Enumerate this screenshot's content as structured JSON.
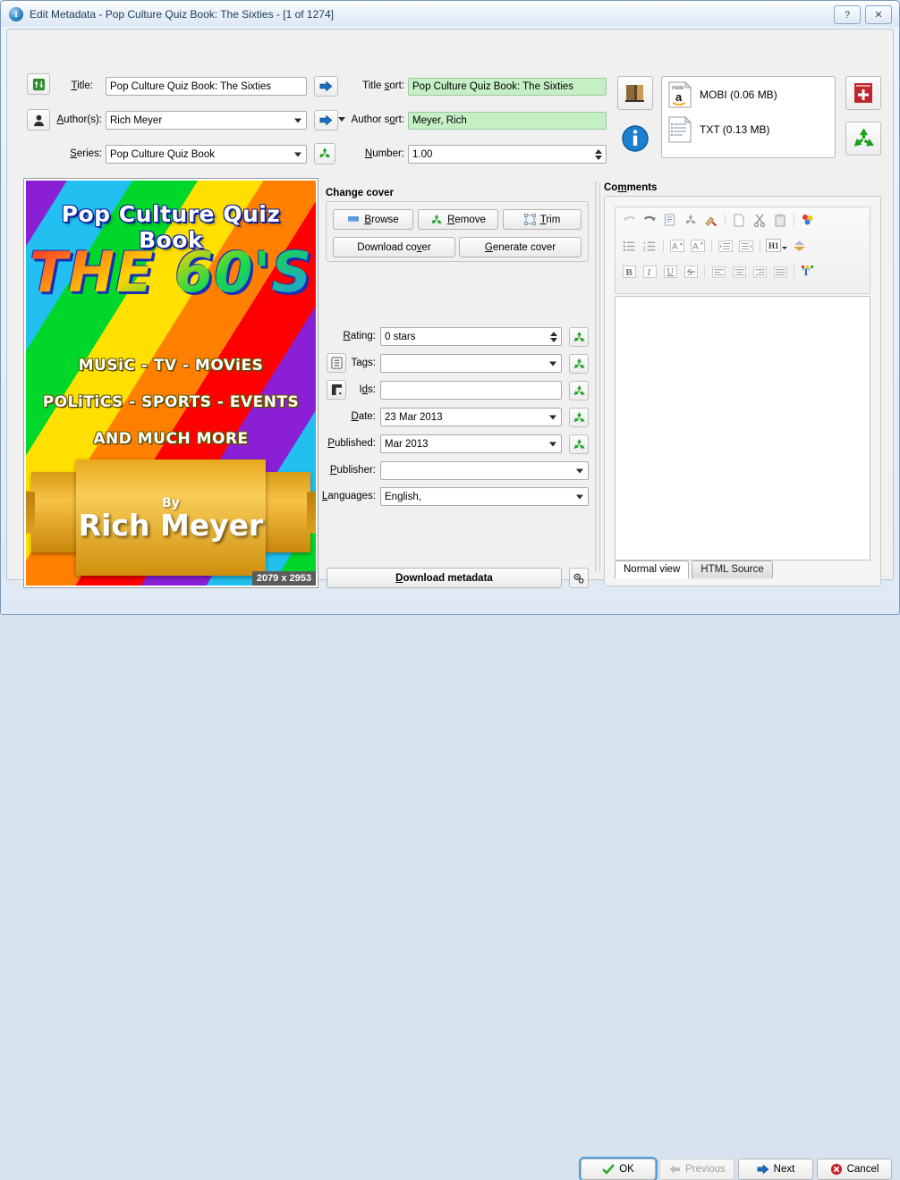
{
  "window": {
    "title": "Edit Metadata - Pop Culture Quiz Book: The Sixties -  [1 of 1274]",
    "icon": "info-icon",
    "help_label": "?",
    "close_label": "✕"
  },
  "metadata": {
    "title_label": "Title:",
    "title_value": "Pop Culture Quiz Book: The Sixties",
    "authors_label": "Author(s):",
    "authors_value": "Rich Meyer",
    "series_label": "Series:",
    "series_value": "Pop Culture Quiz Book",
    "title_sort_label": "Title sort:",
    "title_sort_value": "Pop Culture Quiz Book: The Sixties",
    "author_sort_label": "Author sort:",
    "author_sort_value": "Meyer, Rich",
    "number_label": "Number:",
    "number_value": "1.00"
  },
  "formats": {
    "items": [
      {
        "name": "MOBI (0.06 MB)",
        "icon": "mobi-file-icon",
        "badge": "mobi",
        "mark": "a"
      },
      {
        "name": "TXT (0.13 MB)",
        "icon": "text-file-icon"
      }
    ],
    "book_icon": "book-icon",
    "info_icon": "info-circle-icon",
    "add_format_icon": "add-book-icon",
    "remove_format_icon": "recycle-icon"
  },
  "cover": {
    "frame_label": "cover-preview",
    "title_line": "Pop Culture Quiz Book",
    "decade_line": "THE 60'S",
    "line1": "MUSiC - TV - MOViES",
    "line2": "POLiTiCS - SPORTS - EVENTS",
    "line3": "AND MUCH MORE",
    "by_label": "By",
    "author_name": "Rich Meyer",
    "dimensions": "2079 x 2953"
  },
  "change_cover": {
    "group_title": "Change cover",
    "browse": "Browse",
    "browse_accel": "B",
    "remove": "Remove",
    "remove_accel": "R",
    "trim": "Trim",
    "trim_accel": "T",
    "download_cover": "Download cover",
    "download_cover_accel": "v",
    "generate_cover": "Generate cover",
    "generate_cover_accel": "G"
  },
  "fields": [
    {
      "label": "Rating:",
      "accel": "R",
      "value": "0 stars",
      "kind": "spin",
      "reset": true,
      "side_icon": null
    },
    {
      "label": "Tags:",
      "accel": "g",
      "value": "",
      "kind": "combo",
      "reset": true,
      "side_icon": "tags-icon"
    },
    {
      "label": "Ids:",
      "accel": "d",
      "value": "",
      "kind": "text",
      "reset": true,
      "side_icon": "ids-icon"
    },
    {
      "label": "Date:",
      "accel": "D",
      "value": "23 Mar 2013",
      "kind": "combo",
      "reset": true,
      "side_icon": null
    },
    {
      "label": "Published:",
      "accel": "P",
      "value": "Mar 2013",
      "kind": "combo",
      "reset": true,
      "side_icon": null
    },
    {
      "label": "Publisher:",
      "accel": "P",
      "value": "",
      "kind": "combo",
      "reset": false,
      "side_icon": null
    },
    {
      "label": "Languages:",
      "accel": "L",
      "value": "English,",
      "kind": "combo",
      "reset": false,
      "side_icon": null
    }
  ],
  "download_metadata": {
    "label": "Download metadata",
    "accel": "D",
    "config_icon": "gears-icon"
  },
  "comments": {
    "group_title": "Comments",
    "accel": "m",
    "body": "",
    "toolbar_row1": [
      "undo-icon",
      "redo-icon",
      "paste-formatted-icon",
      "recycle-icon",
      "clear-formatting-icon",
      "copy-icon",
      "cut-icon",
      "paste-icon",
      "color-icon"
    ],
    "toolbar_row2": [
      "bullet-list-icon",
      "numbered-list-icon",
      "increase-font-icon",
      "decrease-font-icon",
      "indent-icon",
      "outdent-icon",
      "heading-icon",
      "background-color-icon"
    ],
    "toolbar_row3": [
      "bold-icon",
      "italic-icon",
      "underline-icon",
      "strikethrough-icon",
      "align-left-icon",
      "align-center-icon",
      "align-right-icon",
      "align-justify-icon",
      "text-color-icon"
    ],
    "tabs": [
      {
        "label": "Normal view",
        "active": true
      },
      {
        "label": "HTML Source",
        "active": false
      }
    ]
  },
  "footer": {
    "ok": "OK",
    "previous": "Previous",
    "next": "Next",
    "cancel": "Cancel"
  },
  "colors": {
    "sort_field_green": "#c5efc5",
    "dialog_bg": "#f0f0f0",
    "accent_blue": "#1a74b8"
  }
}
